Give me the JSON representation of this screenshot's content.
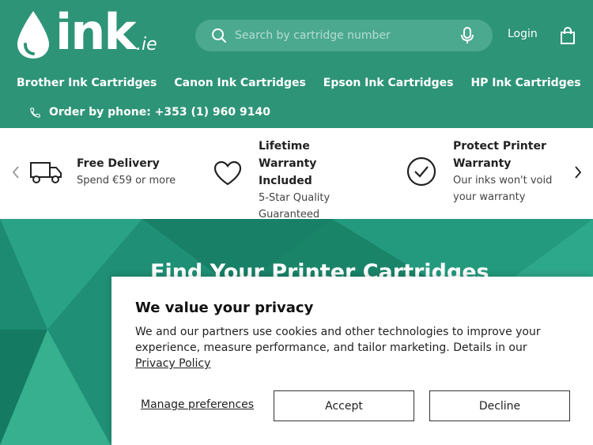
{
  "brand": {
    "logo_text": "ink",
    "logo_tld": ".ie"
  },
  "search": {
    "placeholder": "Search by cartridge number"
  },
  "header": {
    "login_label": "Login"
  },
  "nav": {
    "items": [
      {
        "label": "Brother Ink Cartridges"
      },
      {
        "label": "Canon Ink Cartridges"
      },
      {
        "label": "Epson Ink Cartridges"
      },
      {
        "label": "HP Ink Cartridges"
      }
    ]
  },
  "phone": {
    "text": "Order by phone: +353 (1) 960 9140"
  },
  "features": [
    {
      "title": "Free Delivery",
      "subtitle": "Spend €59 or more",
      "icon": "truck-icon"
    },
    {
      "title": "Lifetime Warranty Included",
      "subtitle": "5-Star Quality Guaranteed",
      "icon": "heart-icon"
    },
    {
      "title": "Protect Printer Warranty",
      "subtitle": "Our inks won't void your warranty",
      "icon": "check-circle-icon"
    }
  ],
  "hero": {
    "title": "Find Your Printer Cartridges"
  },
  "cookie": {
    "title": "We value your privacy",
    "text": "We and our partners use cookies and other technologies to improve your experience, measure performance, and tailor marketing. Details in our",
    "policy_link": "Privacy Policy",
    "manage_label": "Manage preferences",
    "accept_label": "Accept",
    "decline_label": "Decline"
  },
  "colors": {
    "brand_green": "#2e9478",
    "search_bg": "#4aa98f",
    "hero_green": "#1d8a72"
  }
}
